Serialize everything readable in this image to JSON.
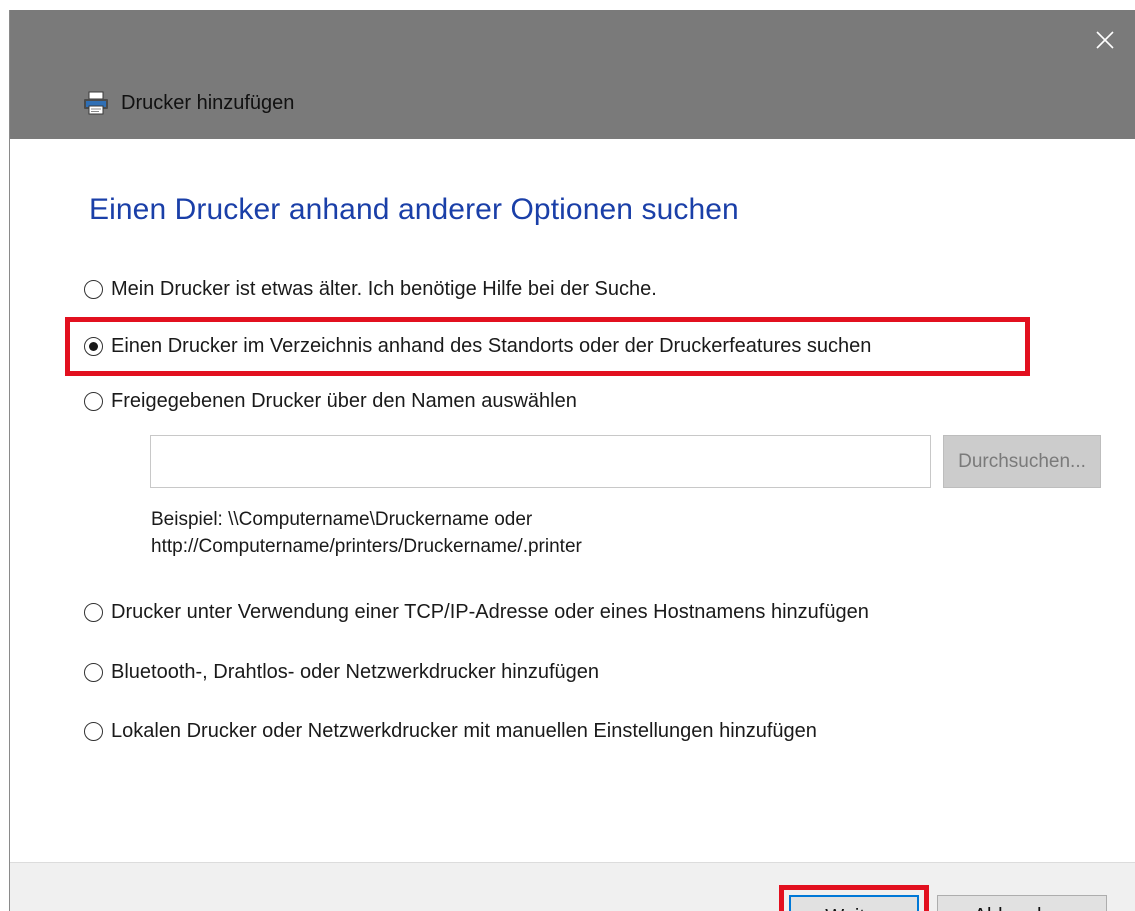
{
  "window": {
    "title": "Drucker hinzufügen",
    "close_icon": "close-icon",
    "app_icon": "printer-icon"
  },
  "heading": "Einen Drucker anhand anderer Optionen suchen",
  "options": [
    {
      "label": "Mein Drucker ist etwas älter. Ich benötige Hilfe bei der Suche.",
      "selected": false
    },
    {
      "label": "Einen Drucker im Verzeichnis anhand des Standorts oder der Druckerfeatures suchen",
      "selected": true
    },
    {
      "label": "Freigegebenen Drucker über den Namen auswählen",
      "selected": false
    },
    {
      "label": "Drucker unter Verwendung einer TCP/IP-Adresse oder eines Hostnamens hinzufügen",
      "selected": false
    },
    {
      "label": "Bluetooth-, Drahtlos- oder Netzwerkdrucker hinzufügen",
      "selected": false
    },
    {
      "label": "Lokalen Drucker oder Netzwerkdrucker mit manuellen Einstellungen hinzufügen",
      "selected": false
    }
  ],
  "shared_printer": {
    "input_value": "",
    "browse_label": "Durchsuchen...",
    "example_line1": "Beispiel: \\\\Computername\\Druckername oder",
    "example_line2": "http://Computername/printers/Druckername/.printer"
  },
  "footer": {
    "next_label": "Weiter",
    "cancel_label": "Abbrechen"
  },
  "colors": {
    "heading": "#1a3fa8",
    "titlebar": "#7a7a7a",
    "highlight": "#e2101f"
  }
}
